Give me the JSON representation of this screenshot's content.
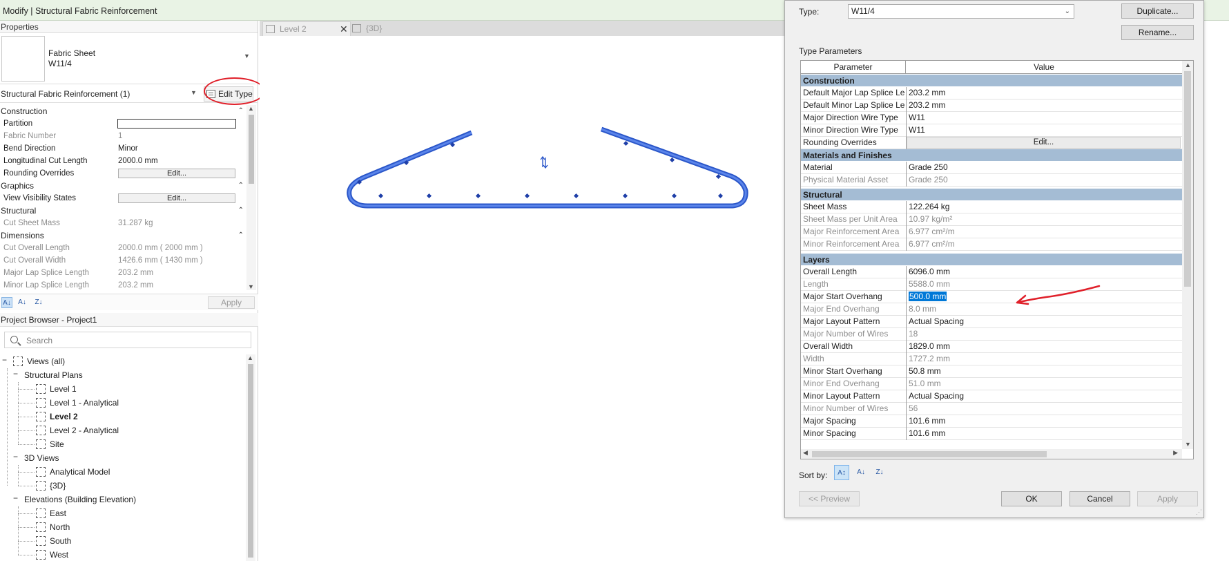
{
  "window": {
    "title": "Modify | Structural Fabric Reinforcement"
  },
  "properties": {
    "panel_title": "Properties",
    "type_family": "Fabric Sheet",
    "type_name": "W11/4",
    "instance_filter": "Structural Fabric Reinforcement (1)",
    "edit_type_label": "Edit Type",
    "apply_label": "Apply",
    "groups": {
      "construction": "Construction",
      "graphics": "Graphics",
      "structural": "Structural",
      "dimensions": "Dimensions"
    },
    "rows": {
      "partition": {
        "k": "Partition",
        "v": ""
      },
      "fabric_number": {
        "k": "Fabric Number",
        "v": "1"
      },
      "bend_direction": {
        "k": "Bend Direction",
        "v": "Minor"
      },
      "long_cut_length": {
        "k": "Longitudinal Cut Length",
        "v": "2000.0 mm"
      },
      "rounding_overrides": {
        "k": "Rounding Overrides",
        "v": "Edit..."
      },
      "view_visibility": {
        "k": "View Visibility States",
        "v": "Edit..."
      },
      "cut_sheet_mass": {
        "k": "Cut Sheet Mass",
        "v": "31.287 kg"
      },
      "cut_overall_length": {
        "k": "Cut Overall Length",
        "v": "2000.0 mm ( 2000 mm )"
      },
      "cut_overall_width": {
        "k": "Cut Overall Width",
        "v": "1426.6 mm ( 1430 mm )"
      },
      "major_lap": {
        "k": "Major Lap Splice Length",
        "v": "203.2 mm"
      },
      "minor_lap": {
        "k": "Minor Lap Splice Length",
        "v": "203.2 mm"
      }
    }
  },
  "browser": {
    "title": "Project Browser - Project1",
    "search_placeholder": "Search",
    "root": "Views (all)",
    "structural_plans": "Structural Plans",
    "sp_items": [
      "Level 1",
      "Level 1 - Analytical",
      "Level 2",
      "Level 2 - Analytical",
      "Site"
    ],
    "views_3d": "3D Views",
    "v3d_items": [
      "Analytical Model",
      "{3D}"
    ],
    "elevations": "Elevations (Building Elevation)",
    "elev_items": [
      "East",
      "North",
      "South",
      "West"
    ]
  },
  "tabs": {
    "active": "Level 2",
    "other": "{3D}"
  },
  "dialog": {
    "type_label": "Type:",
    "type_value": "W11/4",
    "duplicate": "Duplicate...",
    "rename": "Rename...",
    "type_params": "Type Parameters",
    "col_param": "Parameter",
    "col_value": "Value",
    "groups": {
      "construction": "Construction",
      "materials": "Materials and Finishes",
      "structural": "Structural",
      "layers": "Layers"
    },
    "rows": {
      "def_major_lap": {
        "p": "Default Major Lap Splice Le",
        "v": "203.2 mm"
      },
      "def_minor_lap": {
        "p": "Default Minor Lap Splice Le",
        "v": "203.2 mm"
      },
      "major_wire": {
        "p": "Major Direction Wire Type",
        "v": "W11"
      },
      "minor_wire": {
        "p": "Minor Direction Wire Type",
        "v": "W11"
      },
      "rounding": {
        "p": "Rounding Overrides",
        "v": "Edit..."
      },
      "material": {
        "p": "Material",
        "v": "Grade 250"
      },
      "phys_mat": {
        "p": "Physical Material Asset",
        "v": "Grade 250"
      },
      "sheet_mass": {
        "p": "Sheet Mass",
        "v": "122.264 kg"
      },
      "mass_area": {
        "p": "Sheet Mass per Unit Area",
        "v": "10.97 kg/m²"
      },
      "major_area": {
        "p": "Major Reinforcement Area",
        "v": "6.977 cm²/m"
      },
      "minor_area": {
        "p": "Minor Reinforcement Area",
        "v": "6.977 cm²/m"
      },
      "overall_length": {
        "p": "Overall Length",
        "v": "6096.0 mm"
      },
      "length": {
        "p": "Length",
        "v": "5588.0 mm"
      },
      "major_start": {
        "p": "Major Start Overhang",
        "v": "500.0 mm"
      },
      "major_end": {
        "p": "Major End Overhang",
        "v": "8.0 mm"
      },
      "major_layout": {
        "p": "Major Layout Pattern",
        "v": "Actual Spacing"
      },
      "major_num": {
        "p": "Major Number of Wires",
        "v": "18"
      },
      "overall_width": {
        "p": "Overall Width",
        "v": "1829.0 mm"
      },
      "width": {
        "p": "Width",
        "v": "1727.2 mm"
      },
      "minor_start": {
        "p": "Minor Start Overhang",
        "v": "50.8 mm"
      },
      "minor_end": {
        "p": "Minor End Overhang",
        "v": "51.0 mm"
      },
      "minor_layout": {
        "p": "Minor Layout Pattern",
        "v": "Actual Spacing"
      },
      "minor_num": {
        "p": "Minor Number of Wires",
        "v": "56"
      },
      "major_spacing": {
        "p": "Major Spacing",
        "v": "101.6 mm"
      },
      "minor_spacing": {
        "p": "Minor Spacing",
        "v": "101.6 mm"
      }
    },
    "sort_by": "Sort by:",
    "preview": "<< Preview",
    "ok": "OK",
    "cancel": "Cancel",
    "apply": "Apply"
  },
  "colors": {
    "rebar": "#3a66d6",
    "group_header": "#a4bcd4",
    "selection": "#0078d7",
    "annotation": "#e0202a"
  }
}
